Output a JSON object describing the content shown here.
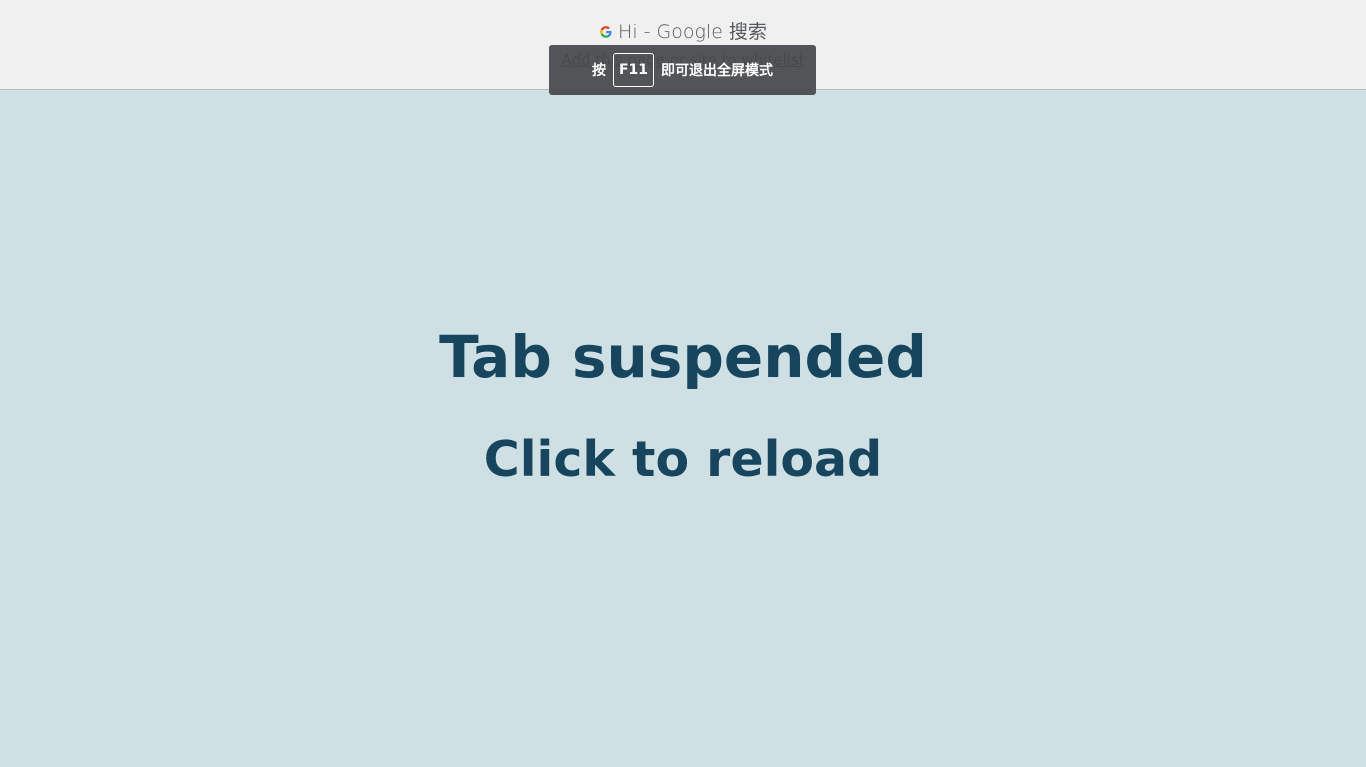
{
  "header": {
    "favicon": "google-g-icon",
    "tab_title": "Hi - Google 搜索",
    "whitelist_link": "Add this page or site to whitelist"
  },
  "fullscreen_toast": {
    "prefix": "按",
    "key": "F11",
    "suffix": "即可退出全屏模式"
  },
  "main": {
    "title": "Tab suspended",
    "subtitle": "Click to reload"
  },
  "colors": {
    "background": "#cfe0e5",
    "topbar": "#f0f0f0",
    "heading": "#17455d",
    "toast": "#46484c"
  }
}
